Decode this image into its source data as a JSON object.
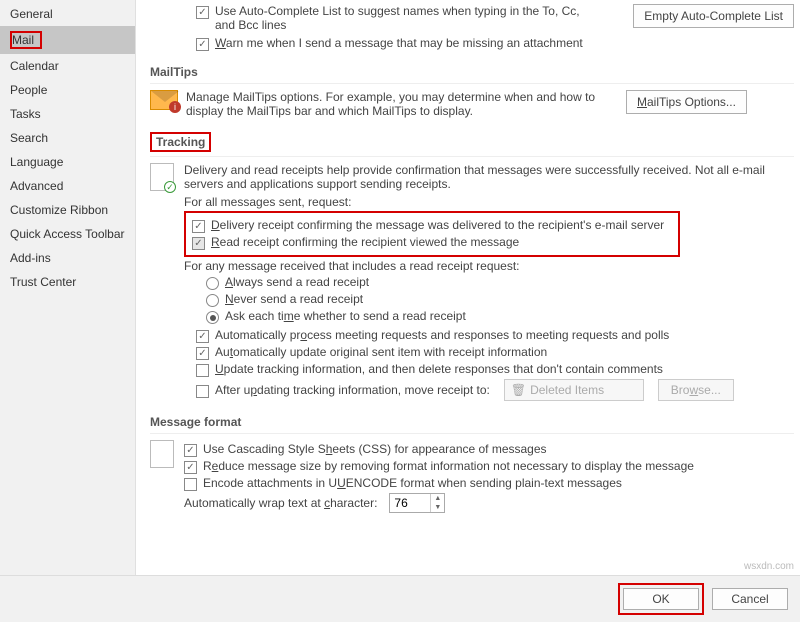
{
  "sidebar": {
    "items": [
      {
        "label": "General"
      },
      {
        "label": "Mail",
        "selected": true,
        "hl": true
      },
      {
        "label": "Calendar"
      },
      {
        "label": "People"
      },
      {
        "label": "Tasks"
      },
      {
        "label": "Search"
      },
      {
        "label": "Language"
      },
      {
        "label": "Advanced"
      },
      {
        "label": "Customize Ribbon"
      },
      {
        "label": "Quick Access Toolbar"
      },
      {
        "label": "Add-ins"
      },
      {
        "label": "Trust Center"
      }
    ]
  },
  "autocomplete": {
    "use_list": "Use Auto-Complete List to suggest names when typing in the To, Cc, and Bcc lines",
    "empty_btn": "Empty Auto-Complete List",
    "warn": "Warn me when I send a message that may be missing an attachment"
  },
  "mailtips": {
    "header": "MailTips",
    "desc": "Manage MailTips options. For example, you may determine when and how to display the MailTips bar and which MailTips to display.",
    "btn": "MailTips Options..."
  },
  "tracking": {
    "header": "Tracking",
    "desc": "Delivery and read receipts help provide confirmation that messages were successfully received. Not all e-mail servers and applications support sending receipts.",
    "for_all": "For all messages sent, request:",
    "delivery": "Delivery receipt confirming the message was delivered to the recipient's e-mail server",
    "read": "Read receipt confirming the recipient viewed the message",
    "for_any": "For any message received that includes a read receipt request:",
    "r_always": "Always send a read receipt",
    "r_never": "Never send a read receipt",
    "r_ask": "Ask each time whether to send a read receipt",
    "auto_proc": "Automatically process meeting requests and responses to meeting requests and polls",
    "auto_upd": "Automatically update original sent item with receipt information",
    "upd_del": "Update tracking information, and then delete responses that don't contain comments",
    "after_upd": "After updating tracking information, move receipt to:",
    "deleted_items": "Deleted Items",
    "browse": "Browse..."
  },
  "msgformat": {
    "header": "Message format",
    "css": "Use Cascading Style Sheets (CSS) for appearance of messages",
    "reduce": "Reduce message size by removing format information not necessary to display the message",
    "uuencode": "Encode attachments in UUENCODE format when sending plain-text messages",
    "wrap_label": "Automatically wrap text at character:",
    "wrap_value": "76"
  },
  "footer": {
    "ok": "OK",
    "cancel": "Cancel"
  },
  "watermark": "wsxdn.com"
}
